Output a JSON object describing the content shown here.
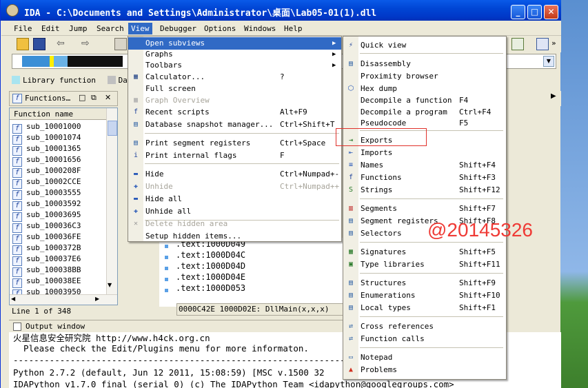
{
  "window": {
    "title": "IDA - C:\\Documents and Settings\\Administrator\\桌面\\Lab05-01(1).dll"
  },
  "menubar": [
    "File",
    "Edit",
    "Jump",
    "Search",
    "View",
    "Debugger",
    "Options",
    "Windows",
    "Help"
  ],
  "legend": {
    "library": "Library function",
    "data": "Data"
  },
  "functions_panel": {
    "title": "Functions…",
    "column": "Function name",
    "rows": [
      "sub_10001000",
      "sub_10001074",
      "sub_10001365",
      "sub_10001656",
      "sub_1000208F",
      "sub_10002CCE",
      "sub_10003555",
      "sub_10003592",
      "sub_10003695",
      "sub_100036C3",
      "sub_100036FE",
      "sub_1000372B",
      "sub_100037E6",
      "sub_100038BB",
      "sub_100038EE",
      "sub_10003950"
    ],
    "status": "Line 1 of 348"
  },
  "code": {
    "lines": [
      ".text:1000D049",
      ".text:1000D04C",
      ".text:1000D04D",
      ".text:1000D04E",
      ".text:1000D053"
    ],
    "status": "0000C42E 1000D02E: DllMain(x,x,x)"
  },
  "output": {
    "title": "Output window",
    "lines": [
      "火星信息安全研究院 http://www.h4ck.org.cn",
      "  Please check the Edit/Plugins menu for more informaton.",
      "---------------------------------------------------------------------------",
      "Python 2.7.2 (default, Jun 12 2011, 15:08:59) [MSC v.1500 32",
      "IDAPython v1.7.0 final (serial 0) (c) The IDAPython Team <idapython@googlegroups.com>"
    ]
  },
  "view_menu": [
    {
      "label": "Open subviews",
      "shortcut": "",
      "icon": "",
      "highlighted": true,
      "submenu": true
    },
    {
      "label": "Graphs",
      "shortcut": "",
      "icon": "",
      "submenu": true
    },
    {
      "label": "Toolbars",
      "shortcut": "",
      "icon": "",
      "submenu": true
    },
    {
      "label": "Calculator...",
      "shortcut": "?",
      "icon": "calculator-icon"
    },
    {
      "label": "Full screen",
      "shortcut": "",
      "icon": ""
    },
    {
      "label": "Graph Overview",
      "shortcut": "",
      "icon": "graph-overview-icon",
      "disabled": true
    },
    {
      "label": "Recent scripts",
      "shortcut": "Alt+F9",
      "icon": "script-icon"
    },
    {
      "label": "Database snapshot manager...",
      "shortcut": "Ctrl+Shift+T",
      "icon": "database-icon"
    },
    {
      "label": "Print segment registers",
      "shortcut": "Ctrl+Space",
      "icon": "segment-registers-icon"
    },
    {
      "label": "Print internal flags",
      "shortcut": "F",
      "icon": "info-icon"
    },
    {
      "label": "Hide",
      "shortcut": "Ctrl+Numpad+-",
      "icon": "minus-icon"
    },
    {
      "label": "Unhide",
      "shortcut": "Ctrl+Numpad++",
      "icon": "plus-icon",
      "disabled": true
    },
    {
      "label": "Hide all",
      "shortcut": "",
      "icon": "minus-icon"
    },
    {
      "label": "Unhide all",
      "shortcut": "",
      "icon": "plus-icon"
    },
    {
      "label": "Delete hidden area",
      "shortcut": "",
      "icon": "delete-icon",
      "disabled": true
    },
    {
      "label": "Setup hidden items...",
      "shortcut": "",
      "icon": ""
    }
  ],
  "subviews_menu": [
    {
      "label": "Quick view",
      "shortcut": "",
      "icon": "quick-view-icon"
    },
    {
      "label": "Disassembly",
      "shortcut": "",
      "icon": "disassembly-icon"
    },
    {
      "label": "Proximity browser",
      "shortcut": "",
      "icon": ""
    },
    {
      "label": "Hex dump",
      "shortcut": "",
      "icon": "hex-dump-icon"
    },
    {
      "label": "Decompile a function",
      "shortcut": "F4",
      "icon": ""
    },
    {
      "label": "Decompile a program",
      "shortcut": "Ctrl+F4",
      "icon": ""
    },
    {
      "label": "Pseudocode",
      "shortcut": "F5",
      "icon": ""
    },
    {
      "label": "Exports",
      "shortcut": "",
      "icon": "exports-icon"
    },
    {
      "label": "Imports",
      "shortcut": "",
      "icon": "imports-icon"
    },
    {
      "label": "Names",
      "shortcut": "Shift+F4",
      "icon": "names-icon"
    },
    {
      "label": "Functions",
      "shortcut": "Shift+F3",
      "icon": "functions-icon"
    },
    {
      "label": "Strings",
      "shortcut": "Shift+F12",
      "icon": "strings-icon"
    },
    {
      "label": "Segments",
      "shortcut": "Shift+F7",
      "icon": "segments-icon"
    },
    {
      "label": "Segment registers",
      "shortcut": "Shift+F8",
      "icon": "segment-registers-icon"
    },
    {
      "label": "Selectors",
      "shortcut": "",
      "icon": "selectors-icon"
    },
    {
      "label": "Signatures",
      "shortcut": "Shift+F5",
      "icon": "signatures-icon"
    },
    {
      "label": "Type libraries",
      "shortcut": "Shift+F11",
      "icon": "type-libraries-icon"
    },
    {
      "label": "Structures",
      "shortcut": "Shift+F9",
      "icon": "structures-icon"
    },
    {
      "label": "Enumerations",
      "shortcut": "Shift+F10",
      "icon": "enumerations-icon"
    },
    {
      "label": "Local types",
      "shortcut": "Shift+F1",
      "icon": "local-types-icon"
    },
    {
      "label": "Cross references",
      "shortcut": "",
      "icon": "cross-references-icon"
    },
    {
      "label": "Function calls",
      "shortcut": "",
      "icon": "function-calls-icon"
    },
    {
      "label": "Notepad",
      "shortcut": "",
      "icon": "notepad-icon"
    },
    {
      "label": "Problems",
      "shortcut": "",
      "icon": "problems-icon"
    }
  ],
  "watermark": "@20145326",
  "colors": {
    "highlight": "#316ac5",
    "library_function": "#a8e4f0",
    "data": "#c0c0c0",
    "watermark": "#ef3a35"
  }
}
